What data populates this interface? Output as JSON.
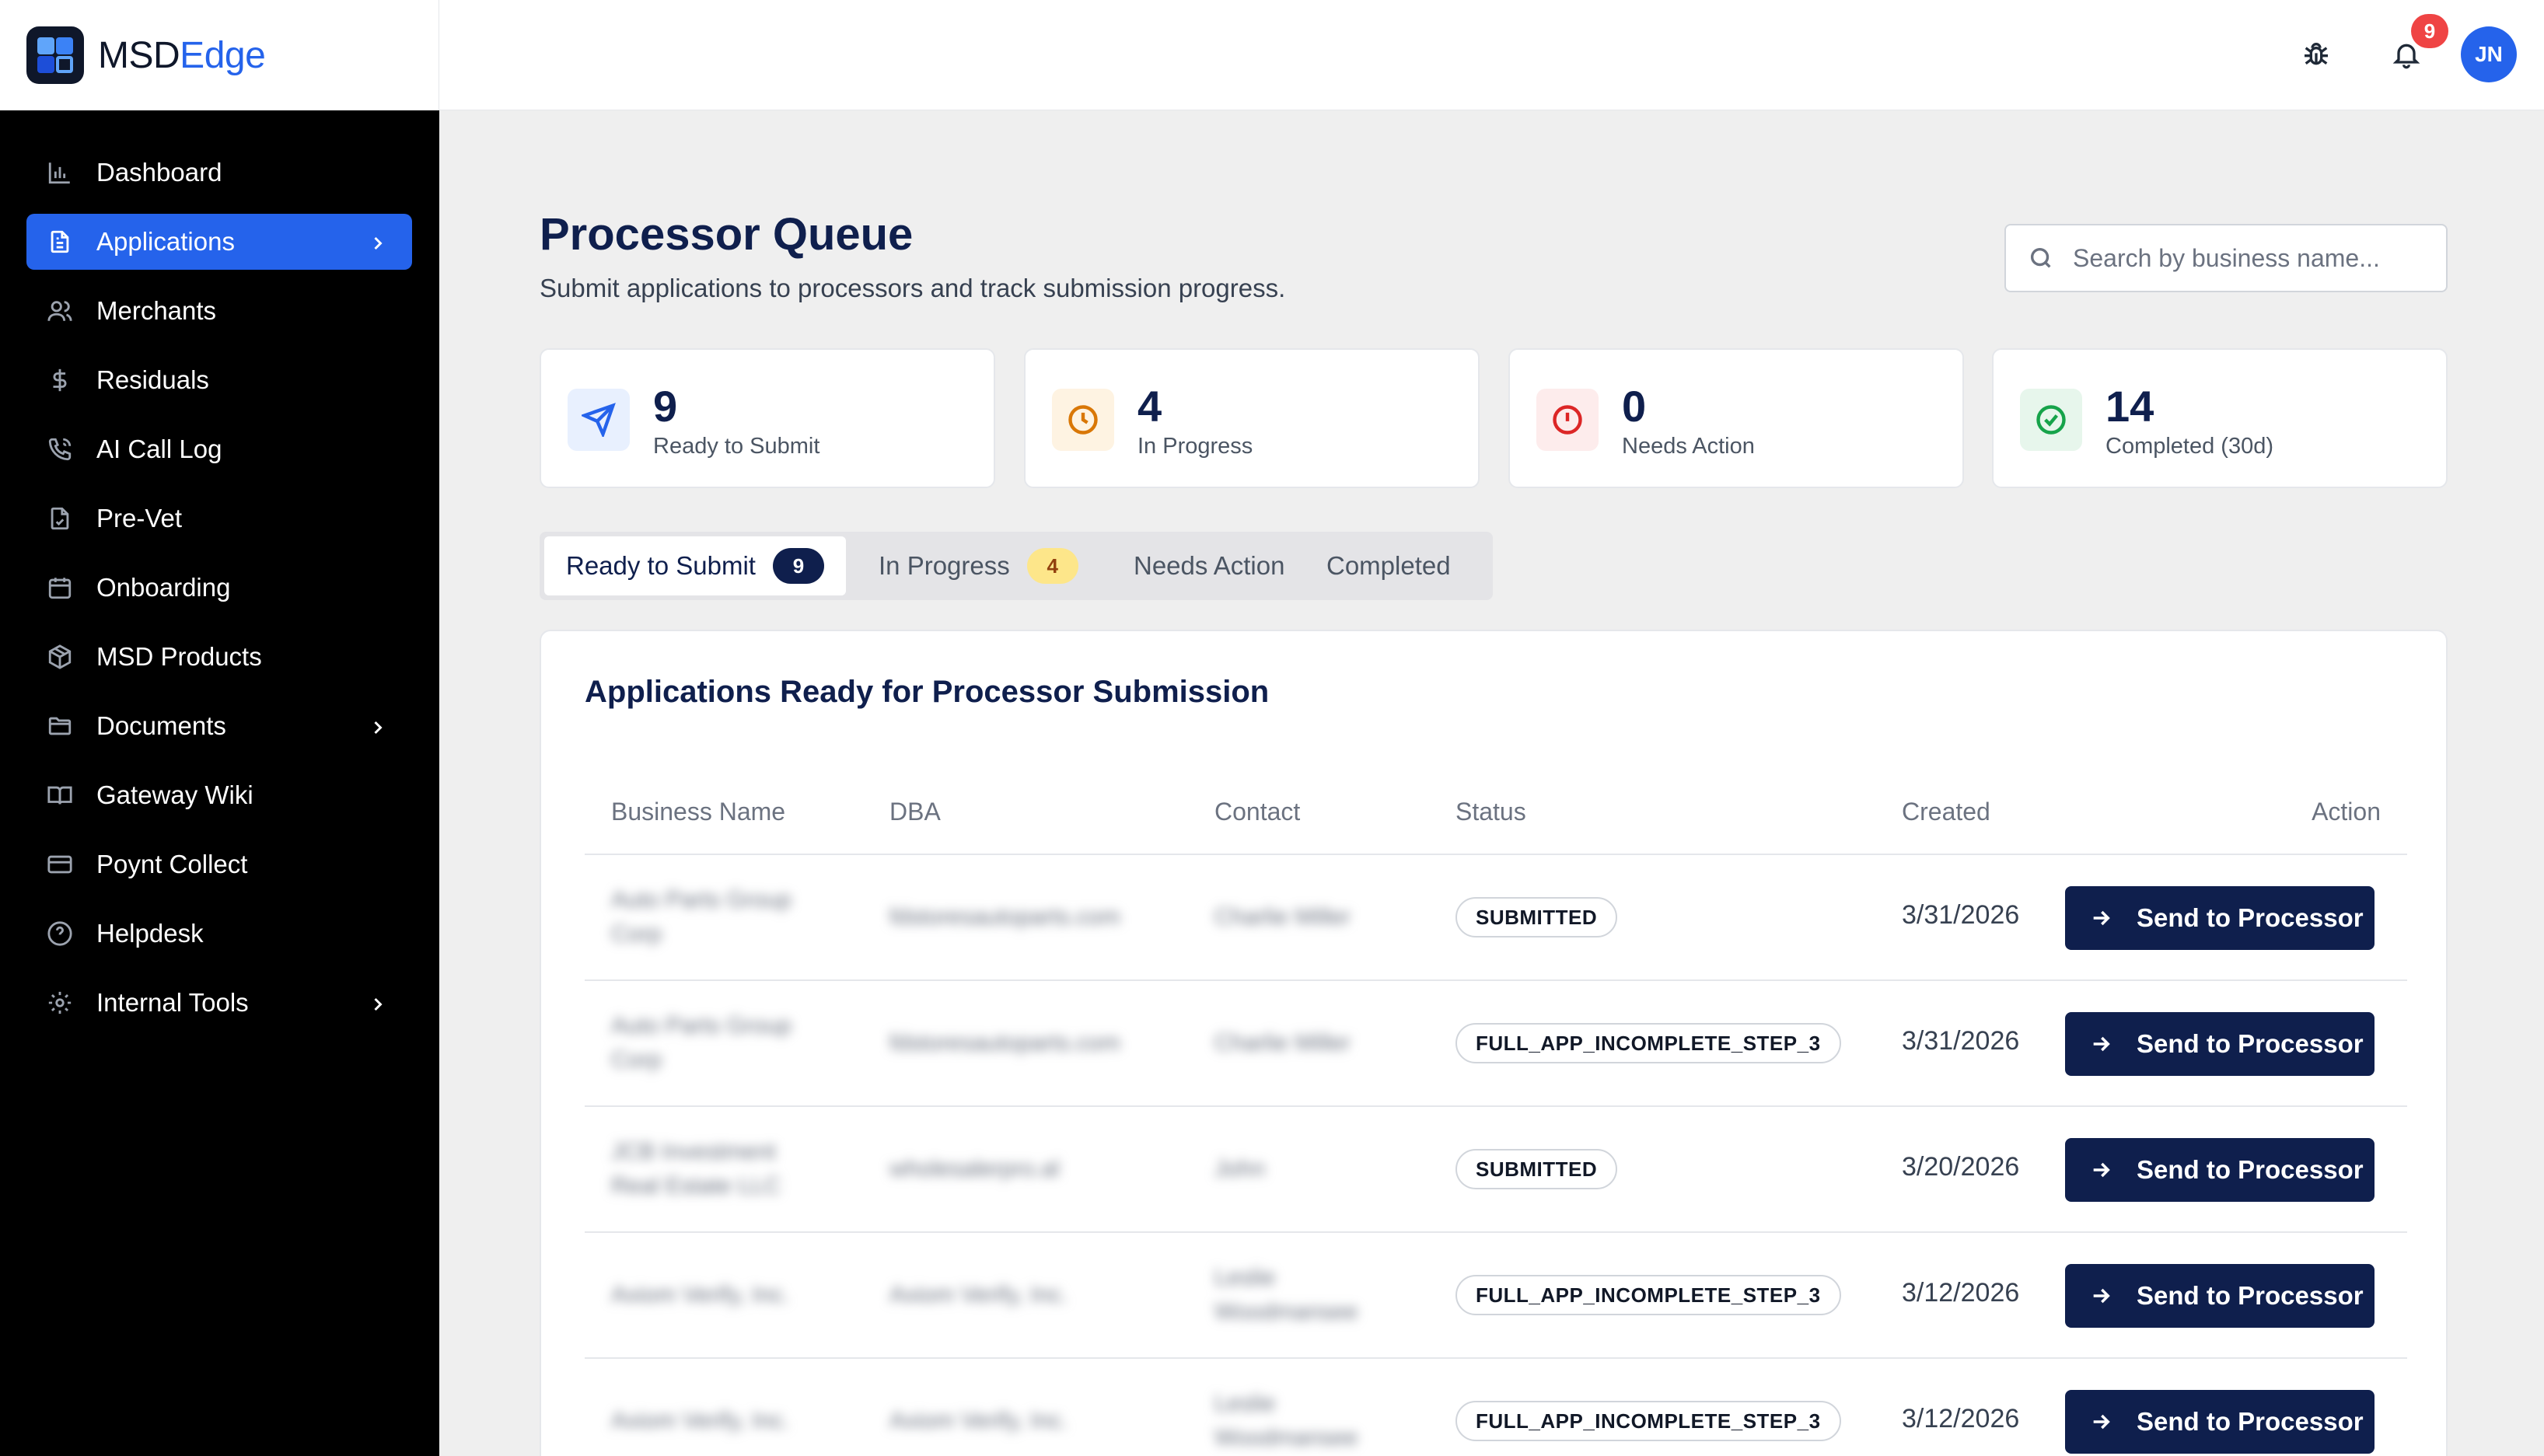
{
  "brand": {
    "name_main": "MSD",
    "name_accent": "Edge"
  },
  "sidebar": {
    "items": [
      {
        "label": "Dashboard",
        "icon": "bar-chart-icon"
      },
      {
        "label": "Applications",
        "icon": "document-icon",
        "active": true,
        "chevron": true
      },
      {
        "label": "Merchants",
        "icon": "users-icon"
      },
      {
        "label": "Residuals",
        "icon": "dollar-icon"
      },
      {
        "label": "AI Call Log",
        "icon": "phone-icon"
      },
      {
        "label": "Pre-Vet",
        "icon": "file-check-icon"
      },
      {
        "label": "Onboarding",
        "icon": "calendar-icon"
      },
      {
        "label": "MSD Products",
        "icon": "package-icon"
      },
      {
        "label": "Documents",
        "icon": "folder-icon",
        "chevron": true
      },
      {
        "label": "Gateway Wiki",
        "icon": "book-icon"
      },
      {
        "label": "Poynt Collect",
        "icon": "credit-card-icon"
      },
      {
        "label": "Helpdesk",
        "icon": "help-circle-icon"
      },
      {
        "label": "Internal Tools",
        "icon": "gear-icon",
        "chevron": true
      }
    ]
  },
  "topbar": {
    "notification_count": "9",
    "avatar_initials": "JN"
  },
  "header": {
    "title": "Processor Queue",
    "subtitle": "Submit applications to processors and track submission progress.",
    "search_placeholder": "Search by business name..."
  },
  "stats": [
    {
      "value": "9",
      "label": "Ready to Submit",
      "icon": "send-icon",
      "color": "#2563eb",
      "bg": "#e8f0fe"
    },
    {
      "value": "4",
      "label": "In Progress",
      "icon": "clock-icon",
      "color": "#d97706",
      "bg": "#fef3e2"
    },
    {
      "value": "0",
      "label": "Needs Action",
      "icon": "alert-circle-icon",
      "color": "#dc2626",
      "bg": "#fdecec"
    },
    {
      "value": "14",
      "label": "Completed (30d)",
      "icon": "check-circle-icon",
      "color": "#16a34a",
      "bg": "#e7f6ec"
    }
  ],
  "tabs": [
    {
      "label": "Ready to Submit",
      "badge": "9",
      "active": true
    },
    {
      "label": "In Progress",
      "badge": "4"
    },
    {
      "label": "Needs Action"
    },
    {
      "label": "Completed"
    }
  ],
  "table": {
    "title": "Applications Ready for Processor Submission",
    "columns": [
      "Business Name",
      "DBA",
      "Contact",
      "Status",
      "Created",
      "Action"
    ],
    "action_label": "Send to Processor",
    "rows": [
      {
        "business_l1": "Auto Parts Group",
        "business_l2": "Corp",
        "dba": "fdstoresautoparts.com",
        "contact_l1": "Charlie Miller",
        "contact_l2": "",
        "status": "SUBMITTED",
        "created": "3/31/2026"
      },
      {
        "business_l1": "Auto Parts Group",
        "business_l2": "Corp",
        "dba": "fdstoresautoparts.com",
        "contact_l1": "Charlie Miller",
        "contact_l2": "",
        "status": "FULL_APP_INCOMPLETE_STEP_3",
        "created": "3/31/2026"
      },
      {
        "business_l1": "JCB Investment",
        "business_l2": "Real Estate LLC",
        "dba": "wholesalerpro.al",
        "contact_l1": "John",
        "contact_l2": "",
        "status": "SUBMITTED",
        "created": "3/20/2026"
      },
      {
        "business_l1": "Axiom Verify, Inc.",
        "business_l2": "",
        "dba": "Axiom Verify, Inc.",
        "contact_l1": "Leslie",
        "contact_l2": "Woodmansee",
        "status": "FULL_APP_INCOMPLETE_STEP_3",
        "created": "3/12/2026"
      },
      {
        "business_l1": "Axiom Verify, Inc.",
        "business_l2": "",
        "dba": "Axiom Verify, Inc.",
        "contact_l1": "Leslie",
        "contact_l2": "Woodmansee",
        "status": "FULL_APP_INCOMPLETE_STEP_3",
        "created": "3/12/2026"
      }
    ]
  }
}
